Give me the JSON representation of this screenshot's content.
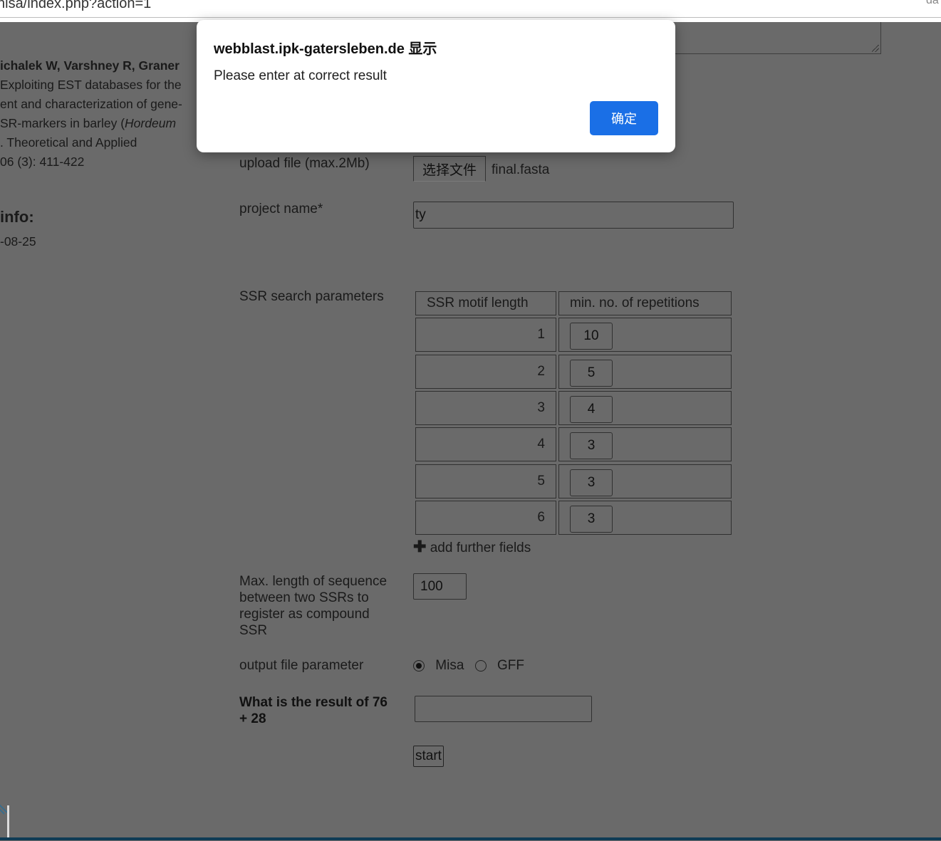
{
  "browser": {
    "url": "nisa/index.php?action=1",
    "corner_text": "da"
  },
  "sidebar": {
    "reference_lines": [
      "ichalek W, Varshney R, Graner",
      "Exploiting EST databases for the",
      "ent and characterization of gene-",
      "SR-markers in barley (",
      "Hordeum",
      ". Theoretical and Applied",
      " 06 (3): 411-422"
    ],
    "info_heading": " info:",
    "info_date": "-08-25"
  },
  "form": {
    "upload_label": "upload file (max.2Mb)",
    "file_button": "选择文件",
    "file_name": "final.fasta",
    "project_label": "project name*",
    "project_value": "ty",
    "ssr_label": "SSR search parameters",
    "table": {
      "headers": [
        "SSR motif length",
        "min. no. of repetitions"
      ],
      "rows": [
        {
          "motif": "1",
          "reps": "10"
        },
        {
          "motif": "2",
          "reps": "5"
        },
        {
          "motif": "3",
          "reps": "4"
        },
        {
          "motif": "4",
          "reps": "3"
        },
        {
          "motif": "5",
          "reps": "3"
        },
        {
          "motif": "6",
          "reps": "3"
        }
      ]
    },
    "add_fields": "add further fields",
    "maxlen_label": [
      "Max. length of sequence",
      "between two SSRs to",
      "register as compound",
      "SSR"
    ],
    "maxlen_value": "100",
    "output_label": "output file parameter",
    "output_options": [
      {
        "label": "Misa",
        "selected": true
      },
      {
        "label": "GFF",
        "selected": false
      }
    ],
    "captcha_label": [
      "What is the result of 76",
      "+ 28"
    ],
    "captcha_value": "",
    "start_button": "start"
  },
  "dialog": {
    "title": "webblast.ipk-gatersleben.de 显示",
    "message": "Please enter at correct result",
    "ok_button": "确定"
  },
  "colors": {
    "dim_background": "#6a6a6a",
    "dialog_button": "#1a6fe6",
    "bottom_line": "#0f3b55"
  }
}
